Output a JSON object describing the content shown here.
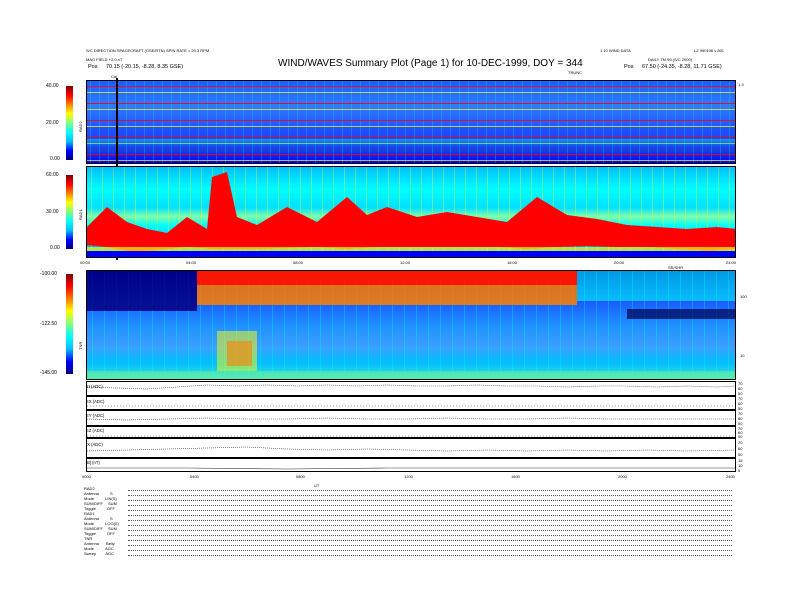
{
  "header": {
    "title": "WIND/WAVES Summary Plot (Page 1) for 10-DEC-1999, DOY = 344",
    "left_line1": "S/C DIRECTION SPACECRAFT (GSE/RTN) SPIN RATE = 20.3 RPM",
    "left_line2": "MAG FIELD +2.0 nT",
    "left_pos_label": "Pos",
    "left_pos_value": "70.15 (-20.15, -8.28, 8.35 GSE)",
    "right_line1": "1.10 WIND DATA",
    "right_line1b": "LZ 990106 v 801",
    "right_line2": "DAILY TM 99 (S/C 2000)",
    "right_pos_label": "Pos",
    "right_pos_value": "67.50 (-24.35, -8.28, 11.71 GSE)",
    "marker_left": "Cal",
    "marker_right": "TRUNC"
  },
  "colorbars": {
    "rad2": {
      "top": "40.00",
      "mid": "20.00",
      "bottom": "0.00",
      "label": "RAD2"
    },
    "rad1": {
      "top": "60.00",
      "mid": "30.00",
      "bottom": "0.00",
      "label": "RAD1"
    },
    "tnr": {
      "top": "-100.00",
      "mid": "-122.50",
      "bottom": "-145.00",
      "label": "TNR"
    }
  },
  "right_axis": {
    "rad2_top": "1.3",
    "rad1_top": "",
    "tnr_100": "100",
    "tnr_10": "10"
  },
  "time_axis_main": [
    "00:00",
    "04:00",
    "08:00",
    "12:00",
    "16:00",
    "20:00",
    "24:00"
  ],
  "time_axis_lower": [
    "0000",
    "0400",
    "0800",
    "1200",
    "1600",
    "2000",
    "2400"
  ],
  "time_axis_center_label": "UT",
  "sub_axis_label": "SR/SHR",
  "line_plots": [
    {
      "label": "EI (ADC)",
      "right": [
        "70",
        "60",
        "50"
      ]
    },
    {
      "label": "EX (ADC)",
      "right": [
        "70",
        "60",
        "50"
      ]
    },
    {
      "label": "EY (ADC)",
      "right": [
        "70",
        "60",
        "50"
      ]
    },
    {
      "label": "EZ (ADC)",
      "right": [
        "70",
        "60",
        "50"
      ]
    },
    {
      "label": "IX (ADC)",
      "right": [
        "70",
        "60",
        "50"
      ]
    },
    {
      "label": "|B| (nT)",
      "right": [
        "15",
        "10",
        "5"
      ]
    }
  ],
  "settings": [
    {
      "k": "RAD2",
      "v": ""
    },
    {
      "k": "Antenna",
      "v": "S"
    },
    {
      "k": "Mode",
      "v": "LIN(S)"
    },
    {
      "k": "SUM/DIFF",
      "v": "SUM"
    },
    {
      "k": "Toggle",
      "v": "OFF"
    },
    {
      "k": "RAD1",
      "v": ""
    },
    {
      "k": "Antenna",
      "v": "S"
    },
    {
      "k": "Mode",
      "v": "LOG(S)"
    },
    {
      "k": "SUM/DIFF",
      "v": "SUM"
    },
    {
      "k": "Toggle",
      "v": "OFF"
    },
    {
      "k": "TNR",
      "v": ""
    },
    {
      "k": "Antenna",
      "v": "Belly"
    },
    {
      "k": "Mode",
      "v": "AGC"
    },
    {
      "k": "Sweep",
      "v": "AGC"
    }
  ],
  "chart_data": [
    {
      "type": "heatmap",
      "name": "RAD2 dynamic spectrum",
      "colorbar_range": [
        0,
        40
      ],
      "x_range": [
        "00:00",
        "24:00"
      ]
    },
    {
      "type": "heatmap",
      "name": "RAD1 dynamic spectrum",
      "colorbar_range": [
        0,
        60
      ],
      "x_range": [
        "00:00",
        "24:00"
      ]
    },
    {
      "type": "heatmap",
      "name": "TNR dynamic spectrum",
      "colorbar_range": [
        -145,
        -100
      ],
      "x_range": [
        "00:00",
        "24:00"
      ]
    },
    {
      "type": "line",
      "name": "EI (ADC)"
    },
    {
      "type": "line",
      "name": "EX (ADC)"
    },
    {
      "type": "line",
      "name": "EY (ADC)"
    },
    {
      "type": "line",
      "name": "EZ (ADC)"
    },
    {
      "type": "line",
      "name": "IX (ADC)"
    },
    {
      "type": "line",
      "name": "|B| (nT)"
    }
  ],
  "colors": {
    "jet": [
      "#000080",
      "#0000ff",
      "#00bfff",
      "#00ffff",
      "#7fff7f",
      "#ffff00",
      "#ff8000",
      "#ff0000",
      "#800000"
    ]
  }
}
